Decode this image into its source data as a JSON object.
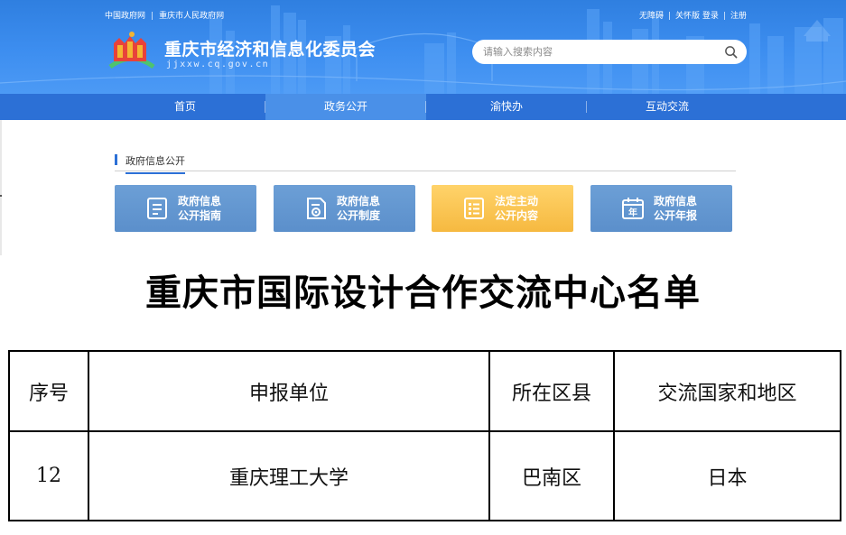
{
  "header": {
    "top_links": [
      "中国政府网",
      "重庆市人民政府网"
    ],
    "right_links": [
      "无障碍",
      "关怀版",
      "登录",
      "注册"
    ],
    "site_title": "重庆市经济和信息化委员会",
    "site_domain": "jjxxw.cq.gov.cn",
    "search": {
      "placeholder": "请输入搜索内容",
      "value": ""
    },
    "colors": {
      "banner": "#3d8ef0",
      "nav": "#2c70d6",
      "nav_active": "#4a90e8"
    }
  },
  "nav": {
    "items": [
      {
        "label": "首页",
        "active": false
      },
      {
        "label": "政务公开",
        "active": true
      },
      {
        "label": "渝快办",
        "active": false
      },
      {
        "label": "互动交流",
        "active": false
      }
    ]
  },
  "section": {
    "title": "政府信息公开",
    "cards": [
      {
        "line1": "政府信息",
        "line2": "公开指南",
        "icon": "guide-document-icon",
        "color": "#5f93cf"
      },
      {
        "line1": "政府信息",
        "line2": "公开制度",
        "icon": "policy-document-icon",
        "color": "#5f93cf"
      },
      {
        "line1": "法定主动",
        "line2": "公开内容",
        "icon": "list-checklist-icon",
        "color": "#f8c14e"
      },
      {
        "line1": "政府信息",
        "line2": "公开年报",
        "icon": "calendar-year-icon",
        "color": "#5f93cf"
      }
    ],
    "calendar_icon_char": "年"
  },
  "document": {
    "title": "重庆市国际设计合作交流中心名单",
    "table": {
      "headers": [
        "序号",
        "申报单位",
        "所在区县",
        "交流国家和地区"
      ],
      "rows": [
        [
          "12",
          "重庆理工大学",
          "巴南区",
          "日本"
        ]
      ]
    }
  }
}
